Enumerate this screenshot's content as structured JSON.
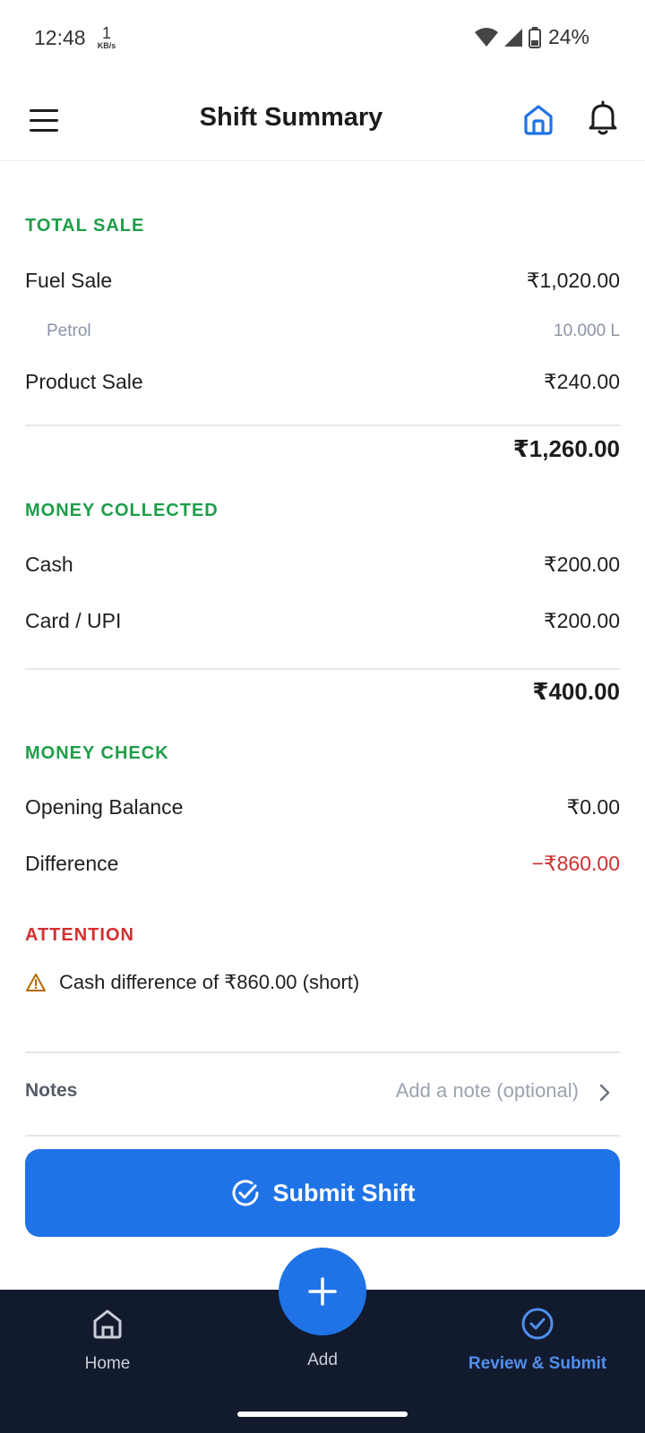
{
  "status_bar": {
    "time": "12:48",
    "net_speed": "1",
    "net_unit": "KB/s",
    "battery": "24%",
    "icons": [
      "wifi-icon",
      "signal-icon",
      "battery-icon"
    ]
  },
  "app_bar": {
    "title": "Shift Summary",
    "icons": [
      "menu-icon",
      "home-icon",
      "bell-icon"
    ],
    "accent": "#1f73e6"
  },
  "total_sale": {
    "label": "TOTAL SALE",
    "fuel_label": "Fuel Sale",
    "fuel_value": "₹1,020.00",
    "petrol_label": "Petrol",
    "petrol_value": "10.000 L",
    "product_label": "Product Sale",
    "product_value": "₹240.00",
    "total": "₹1,260.00"
  },
  "money_collected": {
    "label": "MONEY COLLECTED",
    "cash_label": "Cash",
    "cash_value": "₹200.00",
    "card_label": "Card / UPI",
    "card_value": "₹200.00",
    "total": "₹400.00"
  },
  "money_check": {
    "label": "MONEY CHECK",
    "opening_label": "Opening Balance",
    "opening_value": "₹0.00",
    "difference_label": "Difference",
    "difference_value": "−₹860.00"
  },
  "attention": {
    "label": "ATTENTION",
    "message": "Cash difference of ₹860.00 (short)"
  },
  "notes": {
    "label": "Notes",
    "placeholder": "Add a note (optional)"
  },
  "submit": {
    "label": "Submit Shift"
  },
  "bottom_nav": {
    "home_label": "Home",
    "add_label": "Add",
    "review_label": "Review & Submit",
    "active": "Review & Submit"
  },
  "colors": {
    "section_green": "#1e9e4a",
    "alert_red": "#d32f2f",
    "primary_blue": "#1f73e6",
    "nav_bg": "#121a2e"
  }
}
